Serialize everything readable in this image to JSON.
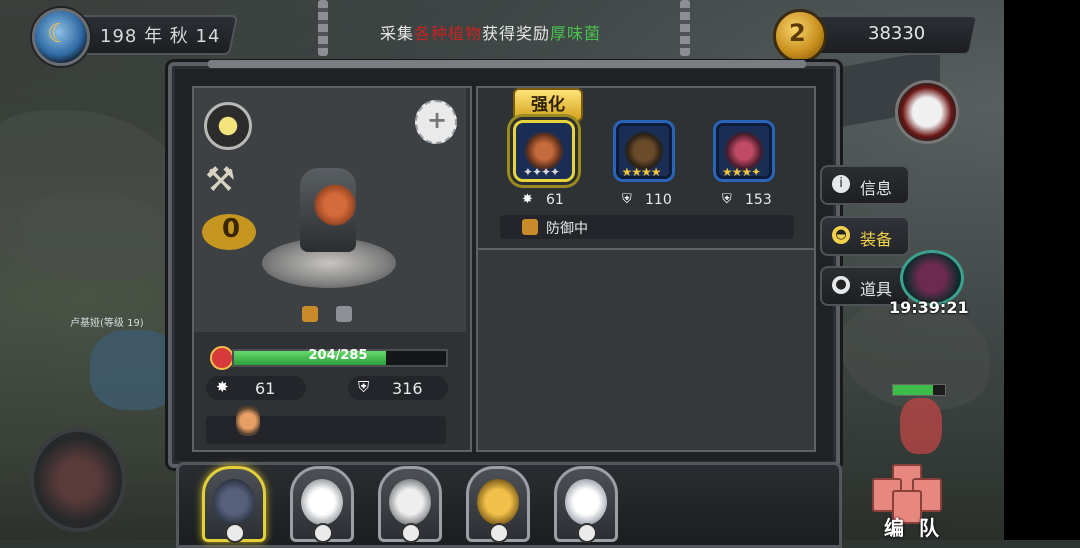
{
  "top_bar": {
    "date": "198 年 秋 14",
    "hint_prefix": "采集",
    "hint_red": "各种植物",
    "hint_mid": "获得奖励",
    "hint_green": "厚味菌",
    "gold": "38330"
  },
  "hero": {
    "hp_text": "204/285",
    "hp_current": 204,
    "hp_max": 285,
    "attack": "61",
    "defense": "316",
    "level_badge": "0"
  },
  "equipment": {
    "enhance_label": "强化",
    "items": [
      {
        "name": "spiked-orb",
        "stars": "✦✦✦✦",
        "stars_color": "silver",
        "stat_icon": "attack",
        "value": "61",
        "selected": true
      },
      {
        "name": "beast-helm",
        "stars": "★★★★",
        "stars_color": "gold",
        "stat_icon": "defense",
        "value": "110",
        "selected": false
      },
      {
        "name": "demon-mask",
        "stars": "★★★✦",
        "stars_color": "gold",
        "stat_icon": "defense",
        "value": "153",
        "selected": false
      }
    ],
    "status_text": "防御中"
  },
  "side_tabs": [
    {
      "label": "信息",
      "icon": "info-icon",
      "active": false
    },
    {
      "label": "装备",
      "icon": "helmet-icon",
      "active": true
    },
    {
      "label": "道具",
      "icon": "bag-icon",
      "active": false
    }
  ],
  "timer": "19:39:21",
  "npc_label": "卢基娅(等级 19)",
  "team": {
    "label": "编 队",
    "slots": [
      {
        "name": "hero-slot-1",
        "selected": true,
        "color": "#3d4a66"
      },
      {
        "name": "hero-slot-2",
        "selected": false,
        "color": "#e9e9e9"
      },
      {
        "name": "hero-slot-3",
        "selected": false,
        "color": "#d9d9d9"
      },
      {
        "name": "hero-slot-4",
        "selected": false,
        "color": "#e6b43b"
      },
      {
        "name": "hero-slot-5",
        "selected": false,
        "color": "#f1f1f1"
      }
    ]
  },
  "colors": {
    "accent_gold": "#e8d33a",
    "hp_green": "#3ebc4a",
    "hint_red": "#c42424",
    "hint_green": "#49c24f"
  }
}
